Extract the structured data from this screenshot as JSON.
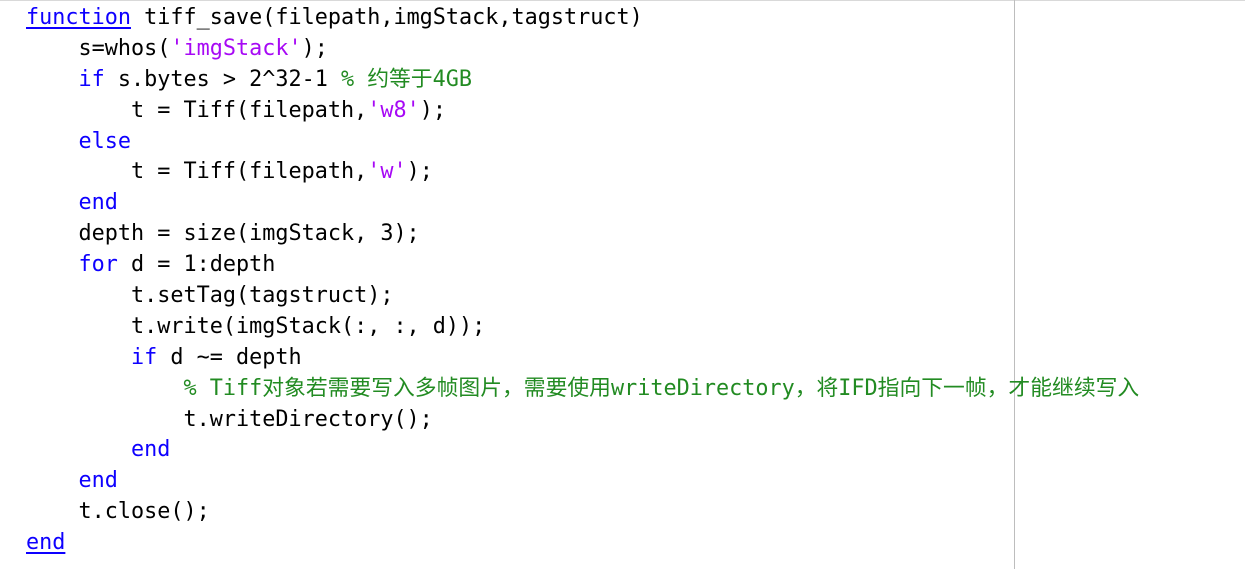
{
  "editor": {
    "language": "MATLAB",
    "colors": {
      "keyword": "#0e00ff",
      "string": "#a709f5",
      "comment": "#228b22",
      "text": "#000000",
      "margin_line": "#bdbdbd"
    },
    "lines": [
      {
        "segments": [
          {
            "type": "keyword",
            "text": "function"
          },
          {
            "type": "text",
            "text": " tiff_save(filepath,imgStack,tagstruct)"
          }
        ]
      },
      {
        "segments": [
          {
            "type": "text",
            "text": "    s=whos("
          },
          {
            "type": "string",
            "text": "'imgStack'"
          },
          {
            "type": "text",
            "text": ");"
          }
        ]
      },
      {
        "segments": [
          {
            "type": "text",
            "text": "    "
          },
          {
            "type": "keyword",
            "text": "if"
          },
          {
            "type": "text",
            "text": " s.bytes > 2^32-1 "
          },
          {
            "type": "comment",
            "text": "% 约等于4GB"
          }
        ]
      },
      {
        "segments": [
          {
            "type": "text",
            "text": "        t = Tiff(filepath,"
          },
          {
            "type": "string",
            "text": "'w8'"
          },
          {
            "type": "text",
            "text": ");"
          }
        ]
      },
      {
        "segments": [
          {
            "type": "text",
            "text": "    "
          },
          {
            "type": "keyword",
            "text": "else"
          }
        ]
      },
      {
        "segments": [
          {
            "type": "text",
            "text": "        t = Tiff(filepath,"
          },
          {
            "type": "string",
            "text": "'w'"
          },
          {
            "type": "text",
            "text": ");"
          }
        ]
      },
      {
        "segments": [
          {
            "type": "text",
            "text": "    "
          },
          {
            "type": "keyword",
            "text": "end"
          }
        ]
      },
      {
        "segments": [
          {
            "type": "text",
            "text": "    depth = size(imgStack, 3);"
          }
        ]
      },
      {
        "segments": [
          {
            "type": "text",
            "text": "    "
          },
          {
            "type": "keyword",
            "text": "for"
          },
          {
            "type": "text",
            "text": " d = 1:depth"
          }
        ]
      },
      {
        "segments": [
          {
            "type": "text",
            "text": "        t.setTag(tagstruct);"
          }
        ]
      },
      {
        "segments": [
          {
            "type": "text",
            "text": "        t.write(imgStack(:, :, d));"
          }
        ]
      },
      {
        "segments": [
          {
            "type": "text",
            "text": "        "
          },
          {
            "type": "keyword",
            "text": "if"
          },
          {
            "type": "text",
            "text": " d ~= depth"
          }
        ]
      },
      {
        "segments": [
          {
            "type": "text",
            "text": "            "
          },
          {
            "type": "comment",
            "text": "% Tiff对象若需要写入多帧图片，需要使用writeDirectory，将IFD指向下一帧，才能继续写入"
          }
        ]
      },
      {
        "segments": [
          {
            "type": "text",
            "text": "            t.writeDirectory();"
          }
        ]
      },
      {
        "segments": [
          {
            "type": "text",
            "text": "        "
          },
          {
            "type": "keyword",
            "text": "end"
          }
        ]
      },
      {
        "segments": [
          {
            "type": "text",
            "text": "    "
          },
          {
            "type": "keyword",
            "text": "end"
          }
        ]
      },
      {
        "segments": [
          {
            "type": "text",
            "text": "    t.close();"
          }
        ]
      },
      {
        "segments": [
          {
            "type": "keyword",
            "text": "end"
          }
        ]
      }
    ]
  }
}
